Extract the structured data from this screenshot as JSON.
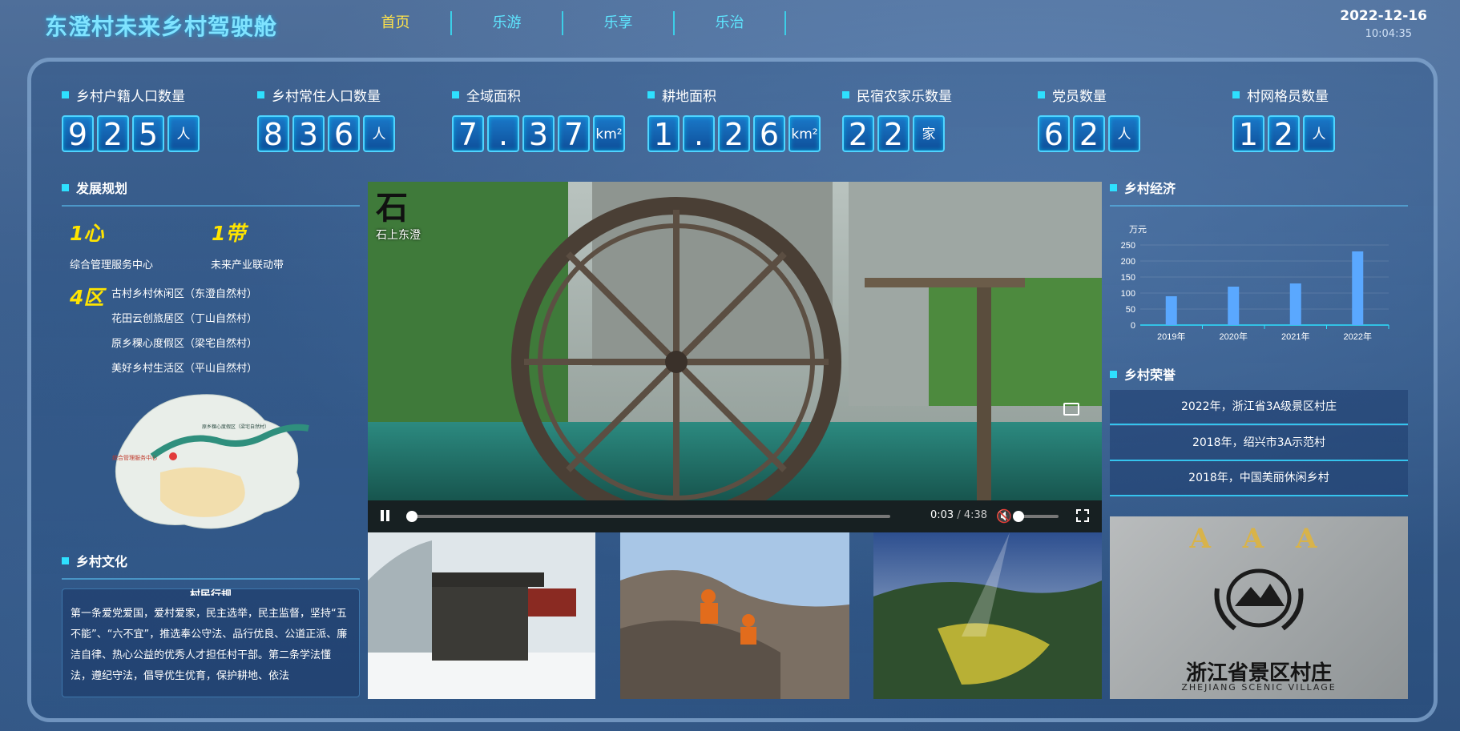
{
  "header": {
    "title": "东澄村未来乡村驾驶舱",
    "nav": [
      "首页",
      "乐游",
      "乐享",
      "乐治"
    ],
    "date": "2022-12-16",
    "time": "10:04:35"
  },
  "stats": [
    {
      "label": "乡村户籍人口数量",
      "digits": [
        "9",
        "2",
        "5"
      ],
      "unit": "人"
    },
    {
      "label": "乡村常住人口数量",
      "digits": [
        "8",
        "3",
        "6"
      ],
      "unit": "人"
    },
    {
      "label": "全域面积",
      "digits": [
        "7",
        ".",
        "3",
        "7"
      ],
      "unit": "km²"
    },
    {
      "label": "耕地面积",
      "digits": [
        "1",
        ".",
        "2",
        "6"
      ],
      "unit": "km²"
    },
    {
      "label": "民宿农家乐数量",
      "digits": [
        "2",
        "2"
      ],
      "unit": "家"
    },
    {
      "label": "党员数量",
      "digits": [
        "6",
        "2"
      ],
      "unit": "人"
    },
    {
      "label": "村网格员数量",
      "digits": [
        "1",
        "2"
      ],
      "unit": "人"
    }
  ],
  "plan": {
    "title": "发展规划",
    "one_heart": "1心",
    "one_heart_desc": "综合管理服务中心",
    "one_belt": "1带",
    "one_belt_desc": "未来产业联动带",
    "four_zones": "4区",
    "zones": [
      "古村乡村休闲区（东澄自然村）",
      "花田云创旅居区（丁山自然村）",
      "原乡稞心度假区（梁宅自然村）",
      "美好乡村生活区（平山自然村）"
    ],
    "map_labels": [
      "综合管理服务中心",
      "原乡稞心度假区（梁宅自然村）"
    ]
  },
  "culture": {
    "title": "乡村文化",
    "heading": "村民行规",
    "text": "第一条爱党爱国，爱村爱家，民主选举，民主监督，坚持“五不能”、“六不宜”，推选奉公守法、品行优良、公道正派、廉洁自律、热心公益的优秀人才担任村干部。第二条学法懂法，遵纪守法，倡导优生优育，保护耕地、依法"
  },
  "video": {
    "logo_text": "石上东澄",
    "time_current": "0:03",
    "time_separator": "/",
    "time_total": "4:38",
    "progress": 0.011,
    "volume": 0.0
  },
  "economy": {
    "title": "乡村经济",
    "chart_data": {
      "type": "bar",
      "categories": [
        "2019年",
        "2020年",
        "2021年",
        "2022年"
      ],
      "values": [
        90,
        120,
        130,
        230
      ],
      "ylabel": "万元",
      "ylim": [
        0,
        250
      ],
      "yticks": [
        0,
        50,
        100,
        150,
        200,
        250
      ],
      "colors": {
        "bar": "#5aa8ff",
        "axis": "#2ee0ff"
      }
    }
  },
  "honors": {
    "title": "乡村荣誉",
    "items": [
      "2022年，浙江省3A级景区村庄",
      "2018年，绍兴市3A示范村",
      "2018年，中国美丽休闲乡村"
    ],
    "plaque_top": "A A A",
    "plaque_main": "浙江省景区村庄",
    "plaque_sub": "ZHEJIANG SCENIC VILLAGE"
  },
  "colors": {
    "accent": "#2ee0ff",
    "active_nav": "#ffe34a",
    "highlight": "#ffe400"
  }
}
